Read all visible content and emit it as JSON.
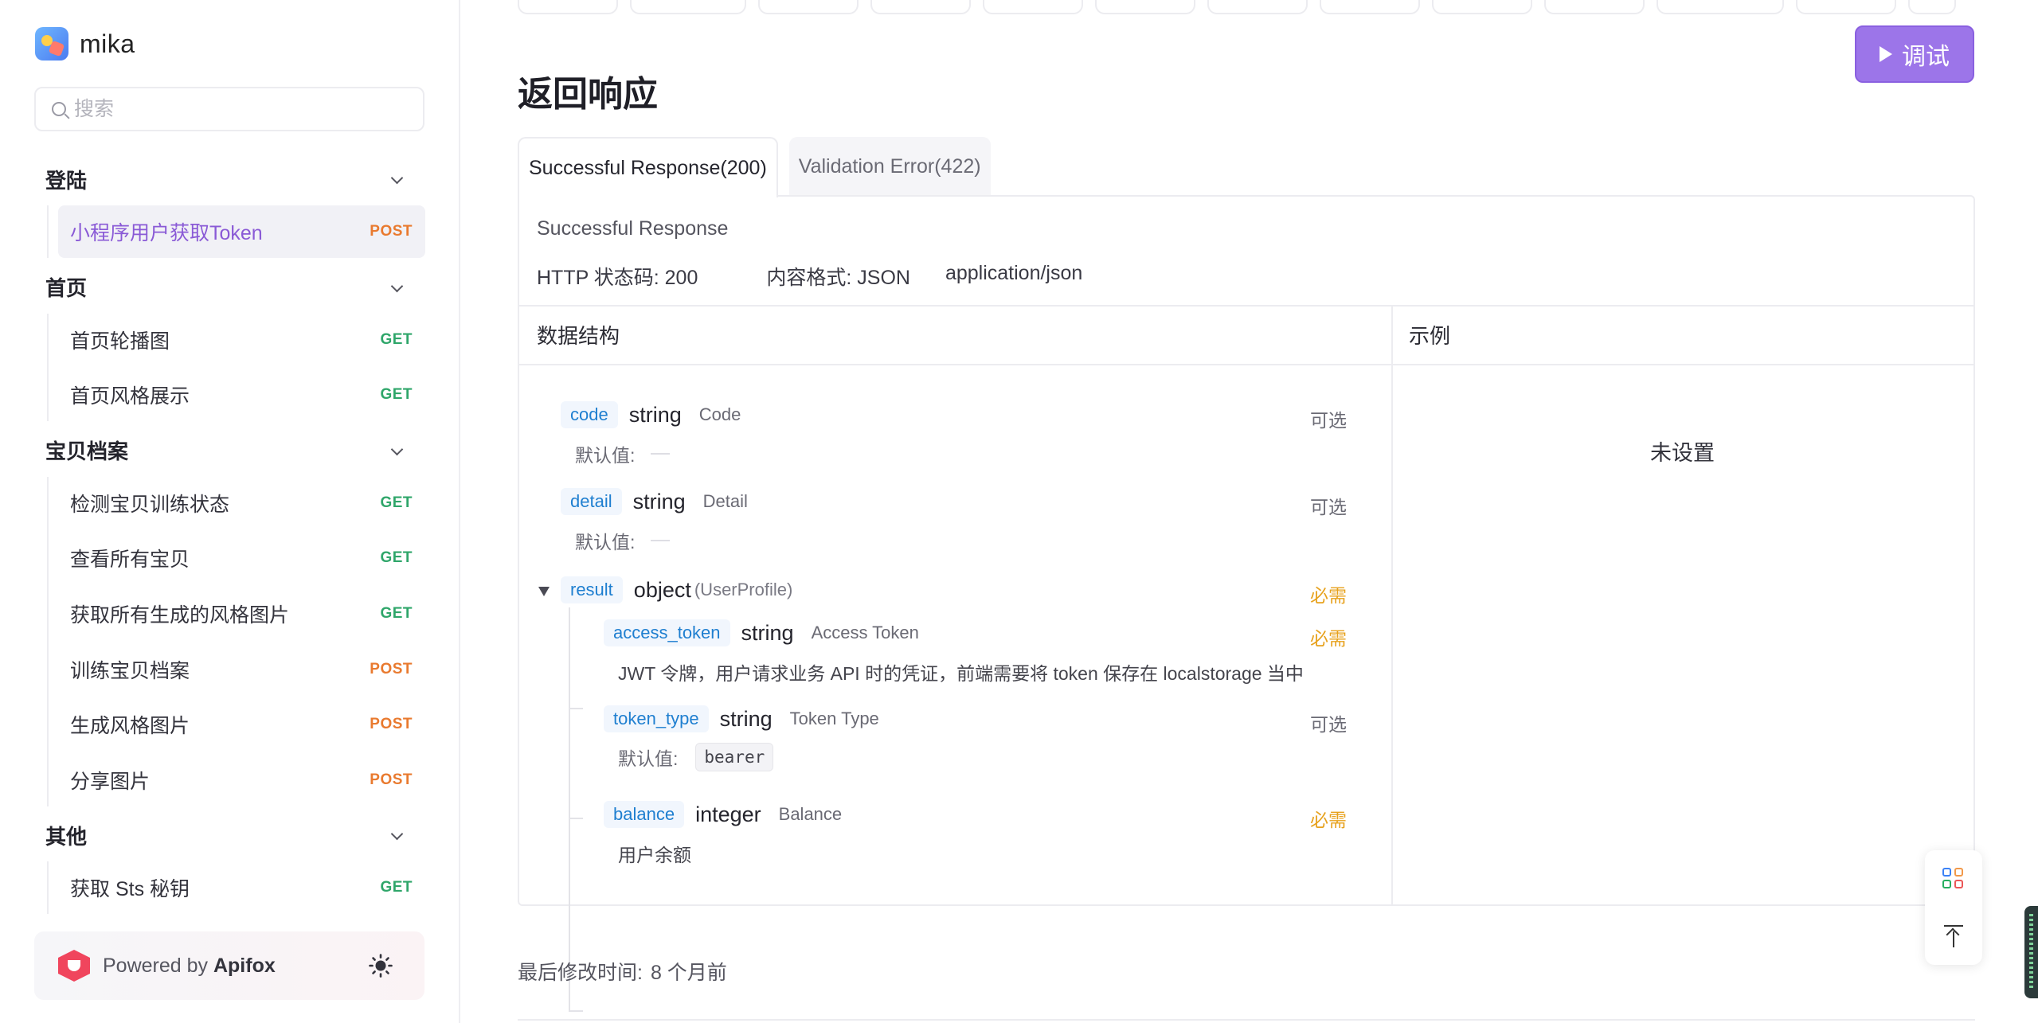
{
  "app": {
    "name": "mika"
  },
  "search": {
    "placeholder": "搜索"
  },
  "nav": {
    "groups": [
      {
        "title": "登陆",
        "items": [
          {
            "label": "小程序用户获取Token",
            "method": "POST",
            "active": true
          }
        ]
      },
      {
        "title": "首页",
        "items": [
          {
            "label": "首页轮播图",
            "method": "GET"
          },
          {
            "label": "首页风格展示",
            "method": "GET"
          }
        ]
      },
      {
        "title": "宝贝档案",
        "items": [
          {
            "label": "检测宝贝训练状态",
            "method": "GET"
          },
          {
            "label": "查看所有宝贝",
            "method": "GET"
          },
          {
            "label": "获取所有生成的风格图片",
            "method": "GET"
          },
          {
            "label": "训练宝贝档案",
            "method": "POST"
          },
          {
            "label": "生成风格图片",
            "method": "POST"
          },
          {
            "label": "分享图片",
            "method": "POST"
          }
        ]
      },
      {
        "title": "其他",
        "items": [
          {
            "label": "获取 Sts 秘钥",
            "method": "GET"
          }
        ]
      }
    ]
  },
  "powered": {
    "prefix": "Powered by",
    "brand": "Apifox"
  },
  "debug": {
    "label": "调试"
  },
  "response": {
    "section_title": "返回响应",
    "tabs": [
      "Successful Response(200)",
      "Validation Error(422)"
    ],
    "description": "Successful Response",
    "status_code": "HTTP 状态码: 200",
    "content_format": "内容格式: JSON",
    "mime": "application/json",
    "schema_header": "数据结构",
    "example_header": "示例",
    "example_empty": "未设置",
    "default_label": "默认值:",
    "fields": {
      "code": {
        "name": "code",
        "type": "string",
        "title": "Code",
        "required": "可选"
      },
      "detail": {
        "name": "detail",
        "type": "string",
        "title": "Detail",
        "required": "可选"
      },
      "result": {
        "name": "result",
        "type": "object",
        "subtype": "(UserProfile)",
        "required": "必需"
      },
      "access_token": {
        "name": "access_token",
        "type": "string",
        "title": "Access Token",
        "required": "必需",
        "description": "JWT 令牌，用户请求业务 API 时的凭证，前端需要将 token 保存在 localstorage 当中"
      },
      "token_type": {
        "name": "token_type",
        "type": "string",
        "title": "Token Type",
        "required": "可选",
        "default": "bearer"
      },
      "balance": {
        "name": "balance",
        "type": "integer",
        "title": "Balance",
        "required": "必需",
        "description": "用户余额"
      }
    }
  },
  "modified": {
    "label": "最后修改时间:",
    "value": "8 个月前"
  },
  "colors": {
    "accent": "#9c75e9",
    "get": "#2fa66a",
    "post": "#e97a2f",
    "required": "#e7a11c",
    "field_name": "#1f7fd0"
  }
}
